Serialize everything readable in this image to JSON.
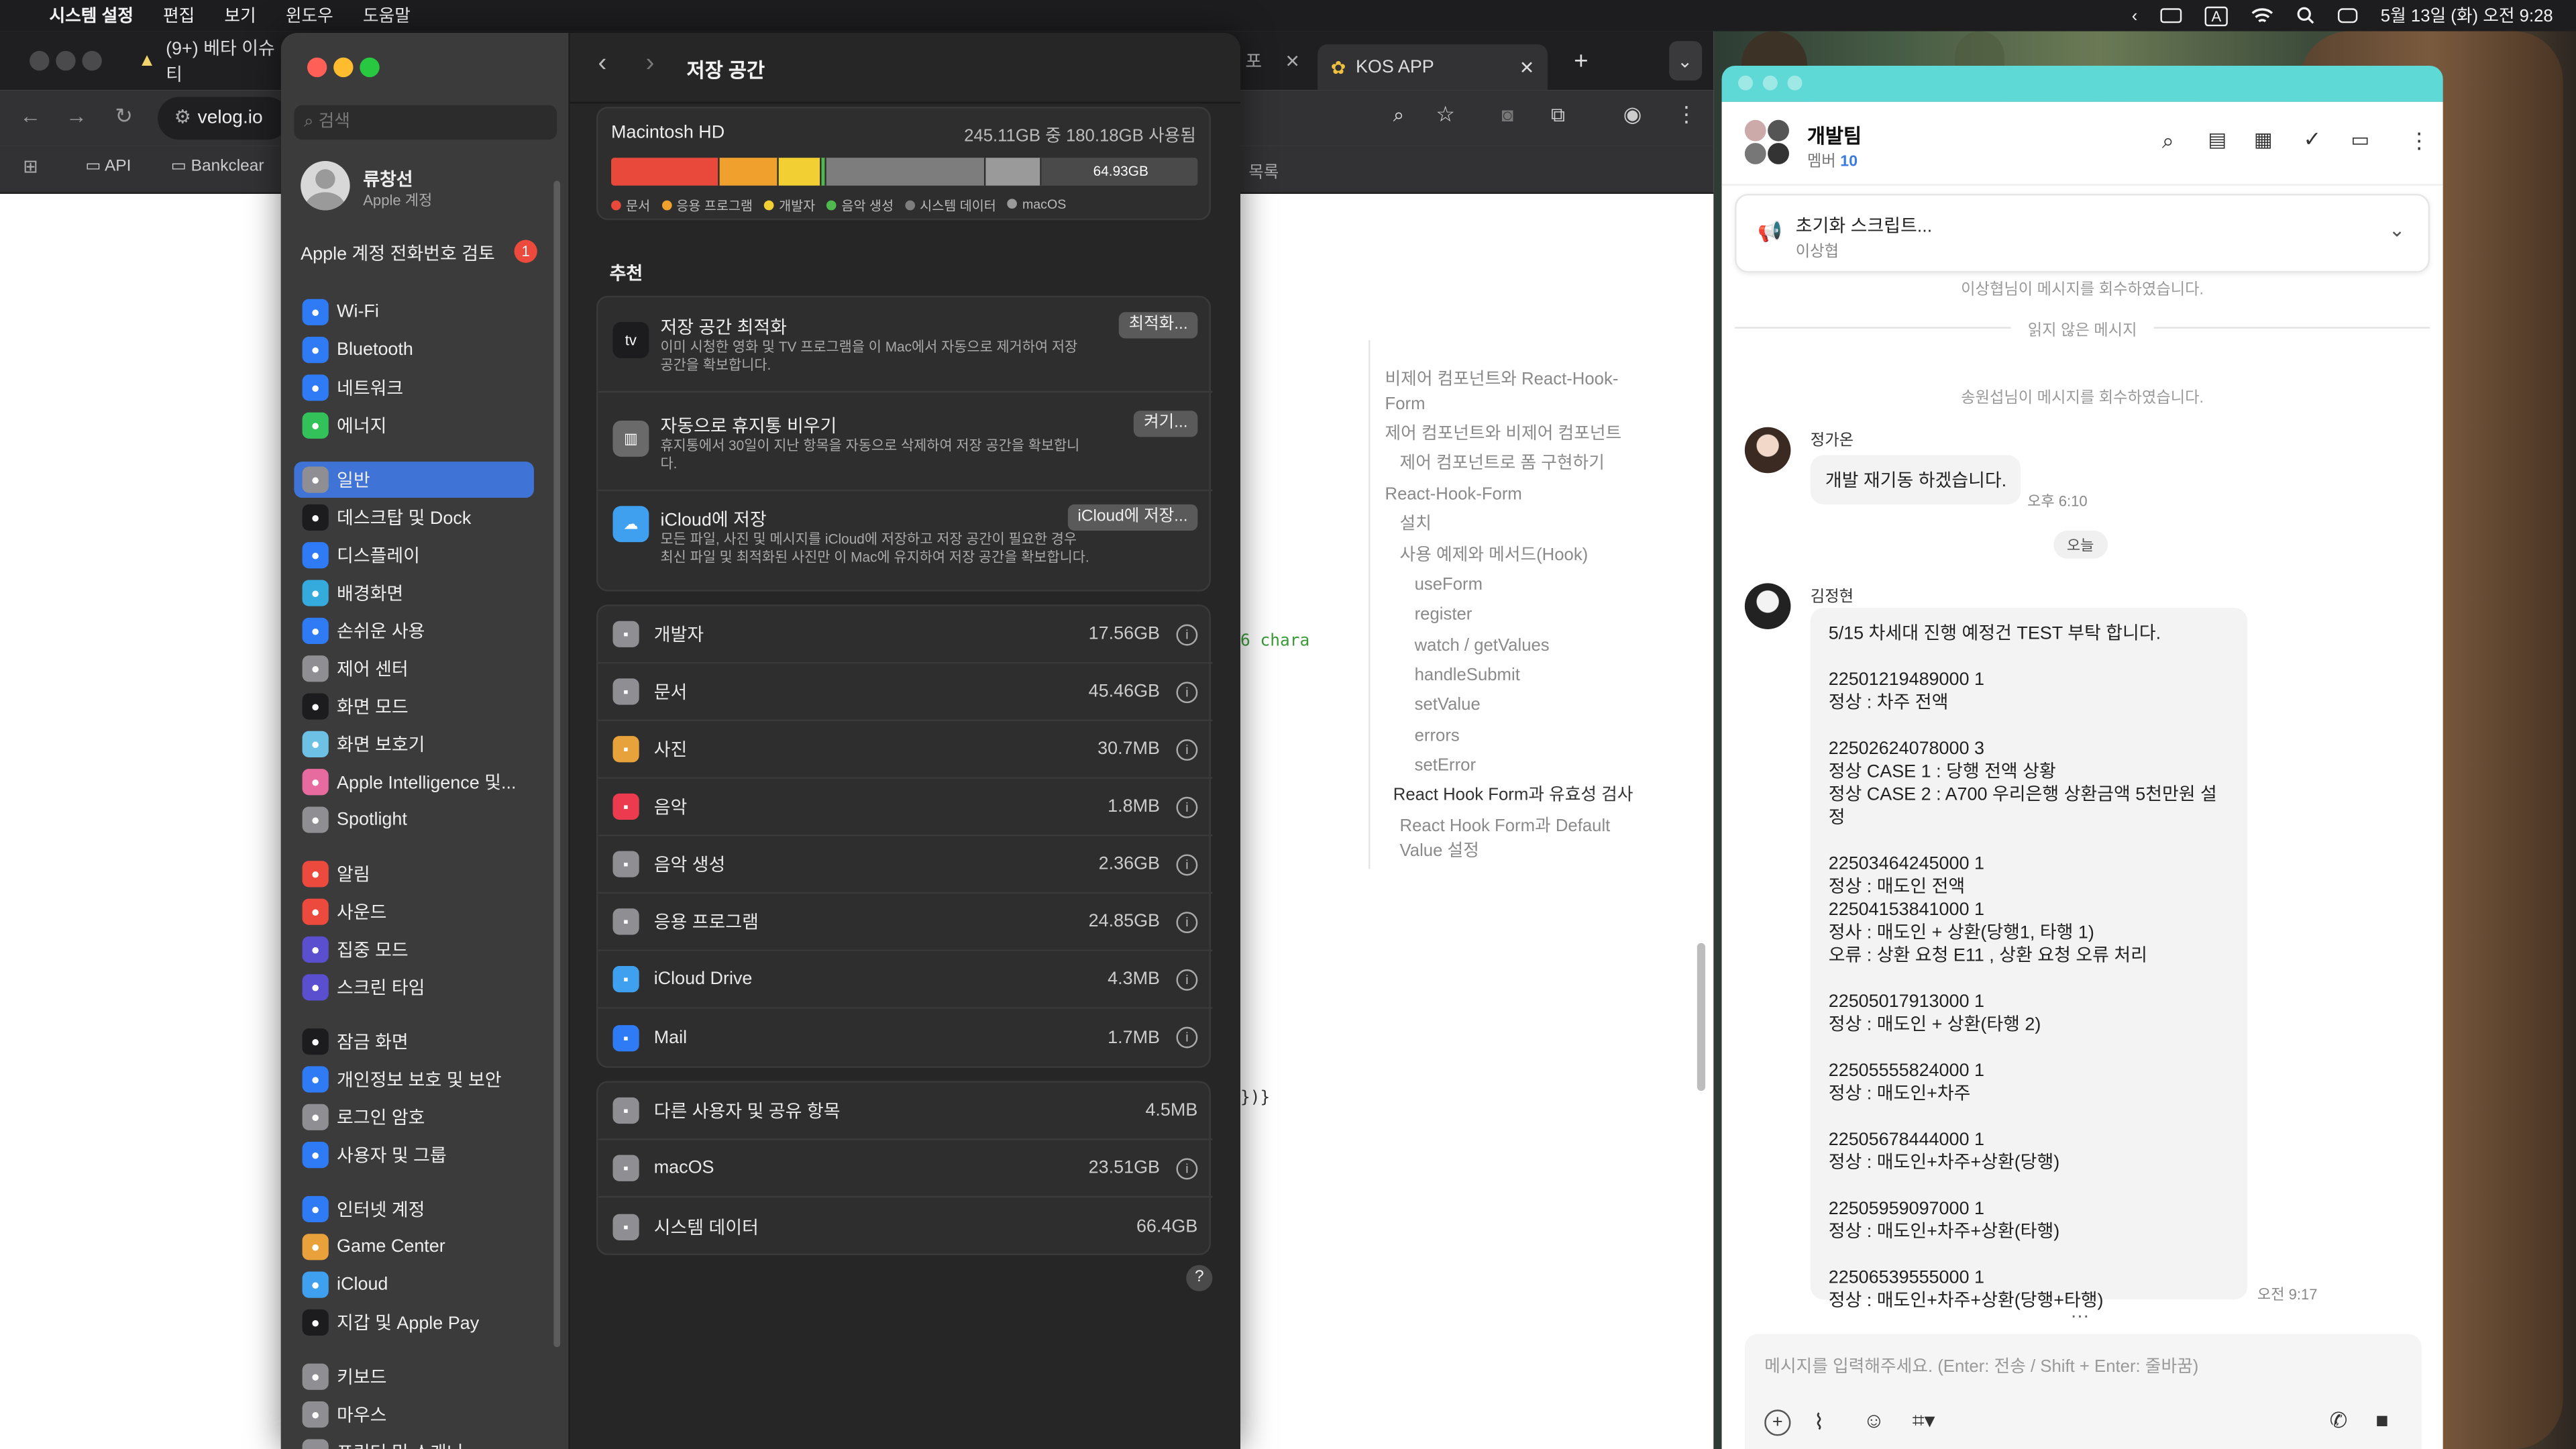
{
  "menubar": {
    "app": "시스템 설정",
    "items": [
      "편집",
      "보기",
      "윈도우",
      "도움말"
    ],
    "datetime": "5월 13일 (화) 오전 9:28",
    "input_mode": "A"
  },
  "browser": {
    "tab1": "(9+) 베타 이슈 티",
    "tab_partial": "포",
    "tab2": "KOS APP",
    "url": "velog.io",
    "bookmarks": [
      "API",
      "Bankclear"
    ],
    "bookmark_right": "목록",
    "code_fragment_1": "6 chara",
    "code_fragment_2": "})}",
    "toc": [
      "비제어 컴포넌트와 React-Hook-",
      "Form",
      "제어 컴포넌트와 비제어 컴포넌트",
      "제어 컴포넌트로 폼 구현하기",
      "React-Hook-Form",
      "설치",
      "사용 예제와 메서드(Hook)",
      "useForm",
      "register",
      "watch / getValues",
      "handleSubmit",
      "setValue",
      "errors",
      "setError",
      "React Hook Form과 유효성 검사",
      "React Hook Form과 Default",
      "Value 설정"
    ]
  },
  "settings": {
    "search_placeholder": "검색",
    "user_name": "류창선",
    "user_sub": "Apple 계정",
    "phone_review": "Apple 계정 전화번호 검토",
    "phone_badge": "1",
    "sidebar_groups": [
      [
        {
          "label": "Wi-Fi",
          "icon": "wifi-icon",
          "color": "#2f7bf5"
        },
        {
          "label": "Bluetooth",
          "icon": "bluetooth-icon",
          "color": "#2f7bf5"
        },
        {
          "label": "네트워크",
          "icon": "globe-icon",
          "color": "#2f7bf5"
        },
        {
          "label": "에너지",
          "icon": "energy-icon",
          "color": "#33c25a"
        }
      ],
      [
        {
          "label": "일반",
          "icon": "gear-icon",
          "color": "#8e8e93",
          "selected": true
        },
        {
          "label": "데스크탑 및 Dock",
          "icon": "dock-icon",
          "color": "#1c1c1e"
        },
        {
          "label": "디스플레이",
          "icon": "display-icon",
          "color": "#2f7bf5"
        },
        {
          "label": "배경화면",
          "icon": "wallpaper-icon",
          "color": "#35aadc"
        },
        {
          "label": "손쉬운 사용",
          "icon": "accessibility-icon",
          "color": "#2f7bf5"
        },
        {
          "label": "제어 센터",
          "icon": "control-center-icon",
          "color": "#8e8e93"
        },
        {
          "label": "화면 모드",
          "icon": "appearance-icon",
          "color": "#1c1c1e"
        },
        {
          "label": "화면 보호기",
          "icon": "screensaver-icon",
          "color": "#6cc1e5"
        },
        {
          "label": "Apple Intelligence 및...",
          "icon": "intelligence-icon",
          "color": "#e86b9f"
        },
        {
          "label": "Spotlight",
          "icon": "spotlight-icon",
          "color": "#8e8e93"
        }
      ],
      [
        {
          "label": "알림",
          "icon": "notification-icon",
          "color": "#ec4a3c"
        },
        {
          "label": "사운드",
          "icon": "sound-icon",
          "color": "#ec4a3c"
        },
        {
          "label": "집중 모드",
          "icon": "focus-icon",
          "color": "#5a4fcf"
        },
        {
          "label": "스크린 타임",
          "icon": "screen-time-icon",
          "color": "#5a4fcf"
        }
      ],
      [
        {
          "label": "잠금 화면",
          "icon": "lock-icon",
          "color": "#1c1c1e"
        },
        {
          "label": "개인정보 보호 및 보안",
          "icon": "privacy-hand-icon",
          "color": "#2f7bf5"
        },
        {
          "label": "로그인 암호",
          "icon": "password-icon",
          "color": "#8e8e93"
        },
        {
          "label": "사용자 및 그룹",
          "icon": "users-icon",
          "color": "#2f7bf5"
        }
      ],
      [
        {
          "label": "인터넷 계정",
          "icon": "at-icon",
          "color": "#2f7bf5"
        },
        {
          "label": "Game Center",
          "icon": "game-center-icon",
          "color": "#e9a23b"
        },
        {
          "label": "iCloud",
          "icon": "icloud-icon",
          "color": "#3fa0f0"
        },
        {
          "label": "지갑 및 Apple Pay",
          "icon": "wallet-icon",
          "color": "#1c1c1e"
        }
      ],
      [
        {
          "label": "키보드",
          "icon": "keyboard-icon",
          "color": "#8e8e93"
        },
        {
          "label": "마우스",
          "icon": "mouse-icon",
          "color": "#8e8e93"
        },
        {
          "label": "프린터 및 스캐너",
          "icon": "printer-icon",
          "color": "#8e8e93"
        }
      ]
    ],
    "title": "저장 공간",
    "disk_name": "Macintosh HD",
    "disk_usage": "245.11GB 중 180.18GB 사용됨",
    "free_label": "64.93GB",
    "storage_bar": [
      {
        "name": "문서",
        "value": 45.46,
        "color": "#e8493b"
      },
      {
        "name": "응용 프로그램",
        "value": 24.85,
        "color": "#f0a02c"
      },
      {
        "name": "개발자",
        "value": 17.56,
        "color": "#f2cf33"
      },
      {
        "name": "음악 생성",
        "value": 2.36,
        "color": "#4fb84f"
      },
      {
        "name": "시스템 데이터",
        "value": 66.4,
        "color": "#7d7d7d"
      },
      {
        "name": "macOS",
        "value": 23.51,
        "color": "#9a9a9a"
      }
    ],
    "storage_total": 245.11,
    "legend": [
      {
        "label": "문서",
        "color": "#e8493b"
      },
      {
        "label": "응용 프로그램",
        "color": "#f0a02c"
      },
      {
        "label": "개발자",
        "color": "#f2cf33"
      },
      {
        "label": "음악 생성",
        "color": "#4fb84f"
      },
      {
        "label": "시스템 데이터",
        "color": "#7d7d7d"
      },
      {
        "label": "macOS",
        "color": "#9a9a9a"
      }
    ],
    "recommend_heading": "추천",
    "recommendations": [
      {
        "title": "저장 공간 최적화",
        "desc": "이미 시청한 영화 및 TV 프로그램을 이 Mac에서 자동으로 제거하여 저장 공간을 확보합니다.",
        "button": "최적화...",
        "icon": "apple-tv-icon"
      },
      {
        "title": "자동으로 휴지통 비우기",
        "desc": "휴지통에서 30일이 지난 항목을 자동으로 삭제하여 저장 공간을 확보합니다.",
        "button": "켜기...",
        "icon": "trash-icon"
      },
      {
        "title": "iCloud에 저장",
        "desc": "모든 파일, 사진 및 메시지를 iCloud에 저장하고 저장 공간이 필요한 경우 최신 파일 및 최적화된 사진만 이 Mac에 유지하여 저장 공간을 확보합니다.",
        "button": "iCloud에 저장...",
        "icon": "icloud-icon"
      }
    ],
    "categories": [
      {
        "label": "개발자",
        "size": "17.56GB",
        "icon": "hammer-icon",
        "color": "#8e8e93"
      },
      {
        "label": "문서",
        "size": "45.46GB",
        "icon": "document-icon",
        "color": "#8e8e93"
      },
      {
        "label": "사진",
        "size": "30.7MB",
        "icon": "photos-icon",
        "color": "#e8a23b"
      },
      {
        "label": "음악",
        "size": "1.8MB",
        "icon": "music-icon",
        "color": "#ec3b4f"
      },
      {
        "label": "음악 생성",
        "size": "2.36GB",
        "icon": "music-creation-icon",
        "color": "#8e8e93"
      },
      {
        "label": "응용 프로그램",
        "size": "24.85GB",
        "icon": "apps-icon",
        "color": "#8e8e93"
      },
      {
        "label": "iCloud Drive",
        "size": "4.3MB",
        "icon": "icloud-drive-icon",
        "color": "#3fa0f0"
      },
      {
        "label": "Mail",
        "size": "1.7MB",
        "icon": "mail-icon",
        "color": "#2f7bf5"
      }
    ],
    "categories2": [
      {
        "label": "다른 사용자 및 공유 항목",
        "size": "4.5MB",
        "icon": "shared-users-icon",
        "color": "#8e8e93",
        "info": false
      },
      {
        "label": "macOS",
        "size": "23.51GB",
        "icon": "macos-icon",
        "color": "#8e8e93",
        "info": true
      },
      {
        "label": "시스템 데이터",
        "size": "66.4GB",
        "icon": "system-data-icon",
        "color": "#8e8e93",
        "info": false
      }
    ],
    "help": "?"
  },
  "chat": {
    "team": "개발팀",
    "member_label": "멤버",
    "member_count": "10",
    "notice_title": "초기화 스크립트...",
    "notice_author": "이상협",
    "sys1": "이상협님이 메시지를 회수하였습니다.",
    "unread": "읽지 않은 메시지",
    "sys2": "송원섭님이 메시지를 회수하였습니다.",
    "msg1_author": "정가온",
    "msg1_text": "개발 재기동 하겠습니다.",
    "msg1_time": "오후 6:10",
    "day_divider": "오늘",
    "msg2_author": "김정현",
    "msg2_lines": [
      "5/15 차세대 진행 예정건 TEST 부탁 합니다.",
      "",
      "22501219489000 1",
      "정상 : 차주 전액",
      "",
      "22502624078000 3",
      "정상 CASE 1 : 당행 전액 상황",
      "정상 CASE 2 : A700 우리은행 상환금액 5천만원 설정",
      "",
      "22503464245000 1",
      "정상 : 매도인 전액",
      "22504153841000 1",
      "정사 : 매도인 + 상환(당행1, 타행 1)",
      "오류 : 상환 요청 E11 , 상환 요청 오류 처리",
      "",
      "22505017913000 1",
      "정상 : 매도인 + 상환(타행 2)",
      "",
      "22505555824000 1",
      "정상 : 매도인+차주",
      "",
      "22505678444000 1",
      "정상 : 매도인+차주+상환(당행)",
      "",
      "22505959097000 1",
      "정상 : 매도인+차주+상환(타행)",
      "",
      "22506539555000 1",
      "정상 : 매도인+차주+상환(당행+타행)"
    ],
    "msg2_time": "오전 9:17",
    "more": "…",
    "input_placeholder": "메시지를 입력해주세요. (Enter: 전송 / Shift + Enter: 줄바꿈)"
  }
}
